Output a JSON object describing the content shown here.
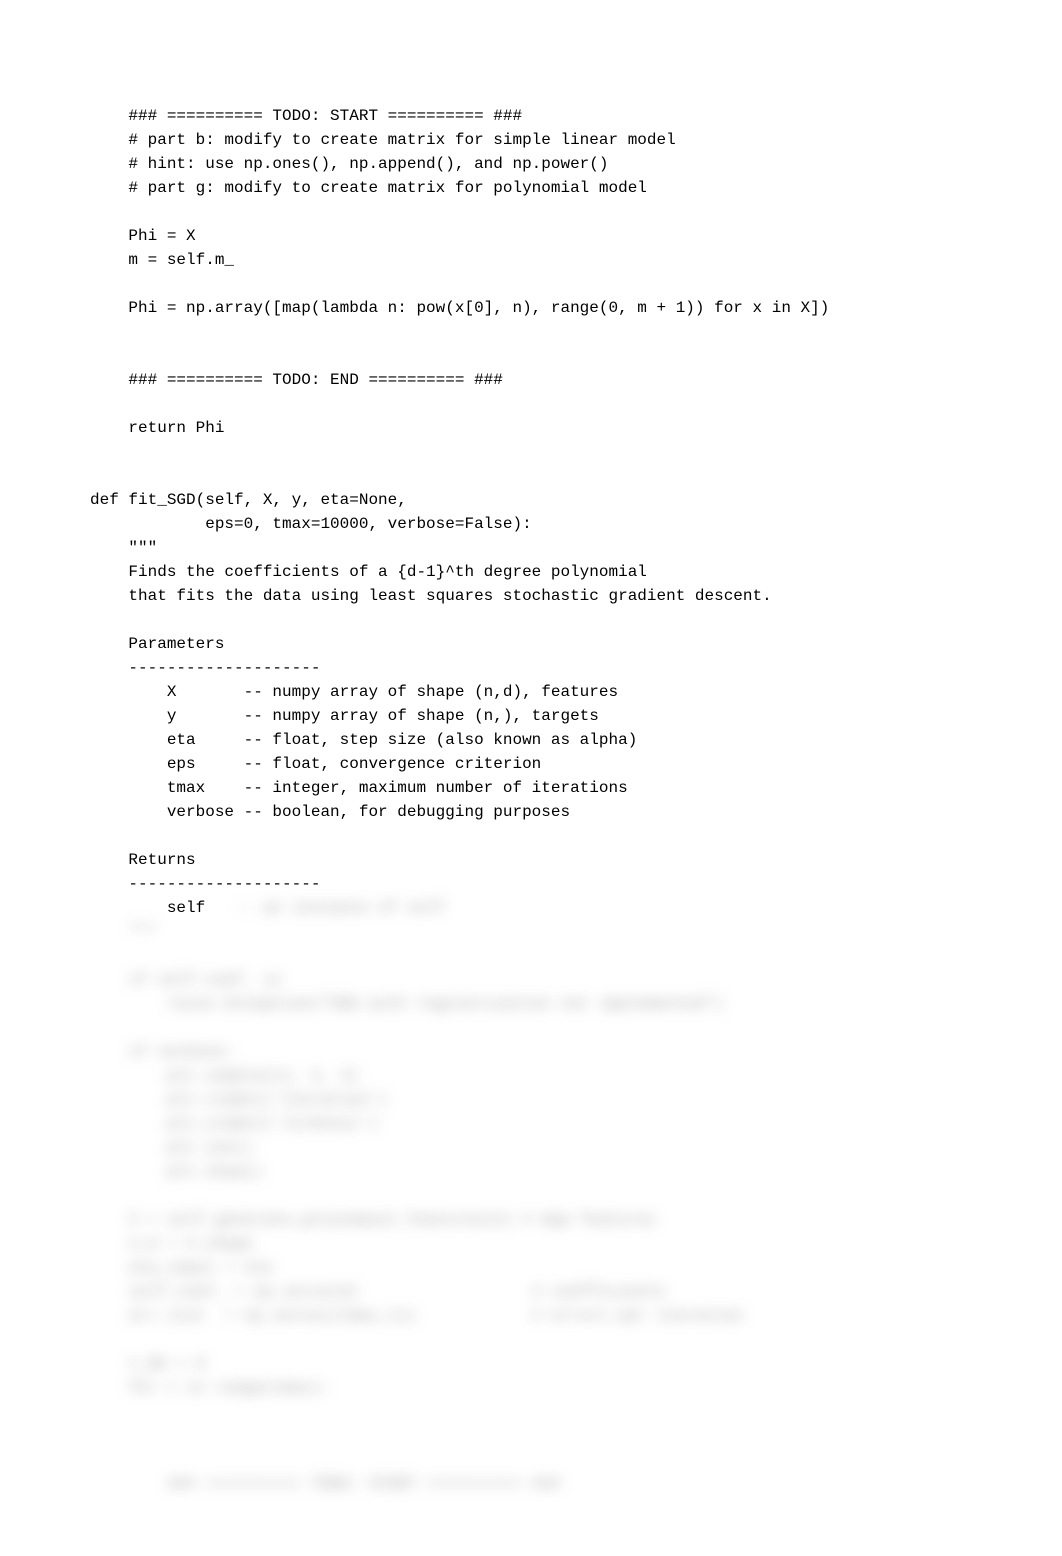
{
  "code": {
    "l01": "    ### ========== TODO: START ========== ###",
    "l02": "    # part b: modify to create matrix for simple linear model",
    "l03": "    # hint: use np.ones(), np.append(), and np.power()",
    "l04": "    # part g: modify to create matrix for polynomial model",
    "l05": "",
    "l06": "    Phi = X",
    "l07": "    m = self.m_",
    "l08": "",
    "l09": "    Phi = np.array([map(lambda n: pow(x[0], n), range(0, m + 1)) for x in X])",
    "l10": "",
    "l11": "",
    "l12": "    ### ========== TODO: END ========== ###",
    "l13": "",
    "l14": "    return Phi",
    "l15": "",
    "l16": "",
    "l17": "def fit_SGD(self, X, y, eta=None,",
    "l18": "            eps=0, tmax=10000, verbose=False):",
    "l19": "    \"\"\"",
    "l20": "    Finds the coefficients of a {d-1}^th degree polynomial",
    "l21": "    that fits the data using least squares stochastic gradient descent.",
    "l22": "",
    "l23": "    Parameters",
    "l24": "    --------------------",
    "l25": "        X       -- numpy array of shape (n,d), features",
    "l26": "        y       -- numpy array of shape (n,), targets",
    "l27": "        eta     -- float, step size (also known as alpha)",
    "l28": "        eps     -- float, convergence criterion",
    "l29": "        tmax    -- integer, maximum number of iterations",
    "l30": "        verbose -- boolean, for debugging purposes",
    "l31": "",
    "l32": "    Returns",
    "l33": "    --------------------",
    "l34": "        self",
    "l34b": "   -- an instance of self",
    "blur01": "    \"\"\"",
    "blur02": "",
    "blur03": "    if self.coef_ is",
    "blur04": "        raise Exception(\"SGD with regularization not implemented\")",
    "blur05": "",
    "blur06": "    if verbose:",
    "blur07": "        plt.subplot(1, 2, 2)",
    "blur08": "        plt.xlabel('iteration')",
    "blur09": "        plt.ylabel('J(theta)')",
    "blur10": "        plt.ion()",
    "blur11": "        plt.show()",
    "blur12": "",
    "blur13": "    X = self.generate_polynomial_features(X) # map features",
    "blur14": "    n,d = X.shape",
    "blur15": "    eta_input = eta",
    "blur16": "    self.coef_ = np.zeros(d)                  # coefficients",
    "blur17": "    err_list  = np.zeros((tmax,1))            # errors per iteration",
    "blur18": "",
    "blur19": "    t_OK = 0",
    "blur20": "    for t in range(tmax):",
    "blur21": "",
    "blur22": "",
    "blur23": "",
    "blur24": "        ### ========== TODO: START ========== ###"
  }
}
